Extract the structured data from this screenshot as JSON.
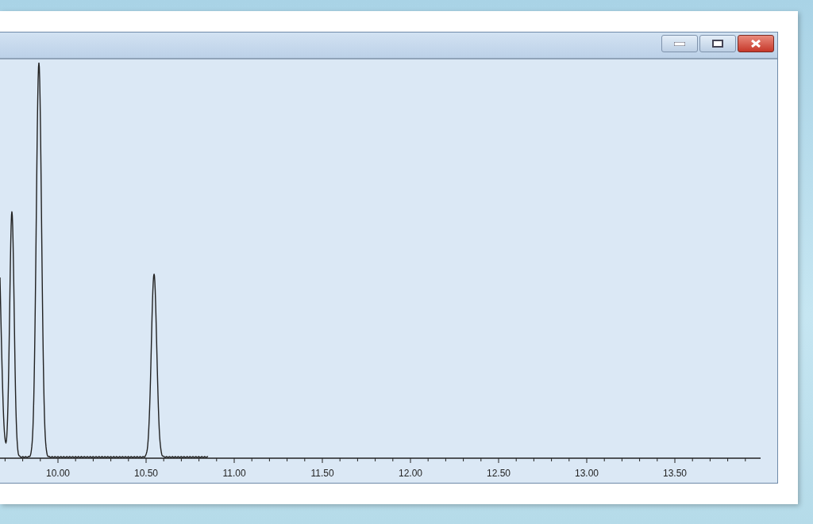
{
  "window": {
    "buttons": [
      {
        "kind": "minimize"
      },
      {
        "kind": "maximize"
      },
      {
        "kind": "close"
      }
    ]
  },
  "chromatogram": {
    "x_tick_labels": [
      "10.00",
      "10.50",
      "11.00",
      "11.50",
      "12.00",
      "12.50",
      "13.00",
      "13.50"
    ]
  }
}
